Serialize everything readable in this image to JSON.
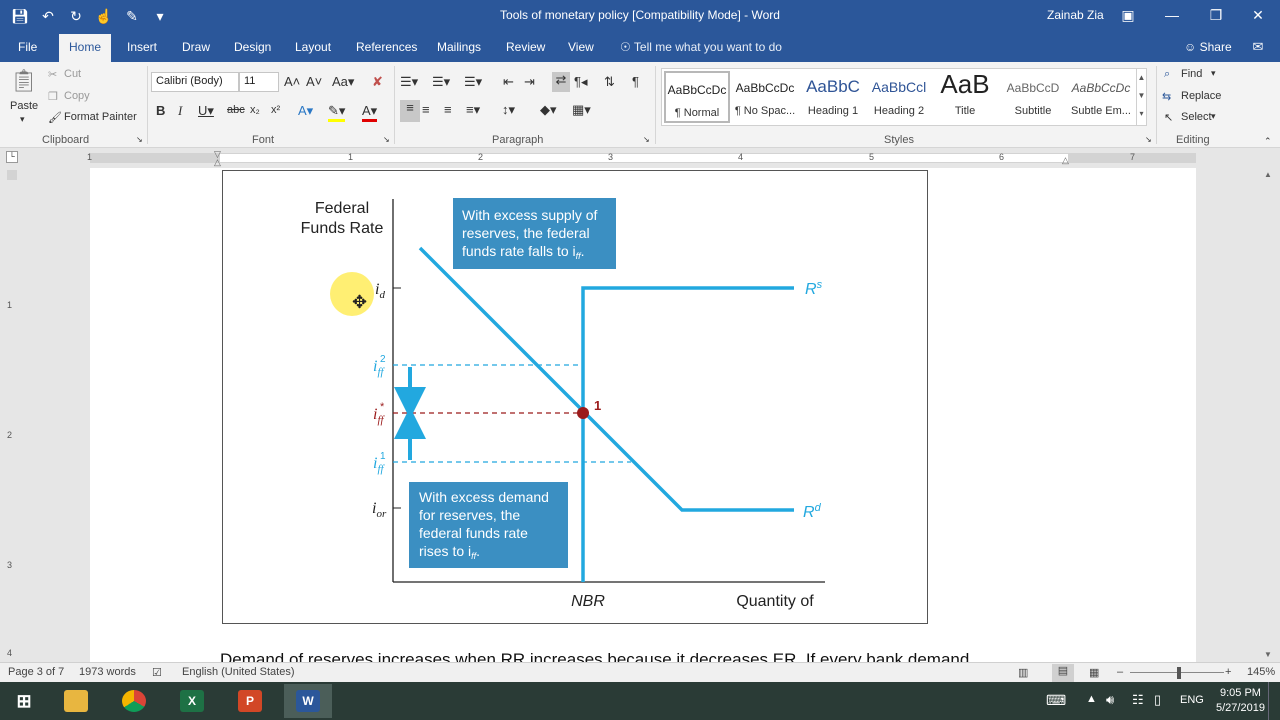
{
  "window": {
    "title": "Tools of monetary policy [Compatibility Mode]  -  Word",
    "user": "Zainab Zia"
  },
  "tabs": {
    "items": [
      "File",
      "Home",
      "Insert",
      "Draw",
      "Design",
      "Layout",
      "References",
      "Mailings",
      "Review",
      "View"
    ],
    "tell_me": "Tell me what you want to do",
    "share": "Share"
  },
  "clipboard": {
    "paste": "Paste",
    "cut": "Cut",
    "copy": "Copy",
    "format_painter": "Format Painter",
    "label": "Clipboard"
  },
  "font": {
    "name": "Calibri (Body)",
    "size": "11",
    "label": "Font"
  },
  "paragraph": {
    "label": "Paragraph"
  },
  "styles": {
    "label": "Styles",
    "items": [
      {
        "preview": "AaBbCcDc",
        "name": "¶ Normal"
      },
      {
        "preview": "AaBbCcDc",
        "name": "¶ No Spac..."
      },
      {
        "preview": "AaBbC",
        "name": "Heading 1"
      },
      {
        "preview": "AaBbCcl",
        "name": "Heading 2"
      },
      {
        "preview": "AaB",
        "name": "Title"
      },
      {
        "preview": "AaBbCcD",
        "name": "Subtitle"
      },
      {
        "preview": "AaBbCcDc",
        "name": "Subtle Em..."
      }
    ]
  },
  "editing": {
    "find": "Find",
    "replace": "Replace",
    "select": "Select",
    "label": "Editing"
  },
  "ruler": {
    "numbers": [
      "1",
      "1",
      "2",
      "3",
      "4",
      "5",
      "6",
      "7"
    ]
  },
  "vruler": {
    "numbers": [
      "1",
      "2",
      "3",
      "4"
    ]
  },
  "figure": {
    "y_title_1": "Federal",
    "y_title_2": "Funds Rate",
    "label_id": "i",
    "label_id_sub": "d",
    "label_iff2": "i",
    "label_iff2_sub": "ff",
    "label_iff2_sup": "2",
    "label_iffstar": "i",
    "label_iffstar_sub": "ff",
    "label_iffstar_sup": "*",
    "label_iff1": "i",
    "label_iff1_sub": "ff",
    "label_iff1_sup": "1",
    "label_ior": "i",
    "label_ior_sub": "or",
    "rs_label": "R",
    "rs_sup": "s",
    "rd_label": "R",
    "rd_sup": "d",
    "point_label": "1",
    "x_nbr": "NBR",
    "x_title": "Quantity of",
    "box_top_1": "With excess supply of",
    "box_top_2": "reserves, the federal",
    "box_top_3": "funds rate falls to i",
    "box_top_3_sub": "ff",
    "box_top_3_end": ".",
    "box_bottom_1": "With excess demand",
    "box_bottom_2": "for reserves, the",
    "box_bottom_3": "federal funds rate",
    "box_bottom_4": "rises to i",
    "box_bottom_4_sub": "ff",
    "box_bottom_4_end": "."
  },
  "doc": {
    "body_text": "Demand of reserves increases when RR increases because it decreases ER. If every bank demand"
  },
  "status": {
    "page": "Page 3 of 7",
    "words": "1973 words",
    "language": "English (United States)",
    "zoom": "145%"
  },
  "taskbar": {
    "lang": "ENG",
    "time": "9:05 PM",
    "date": "5/27/2019"
  },
  "colors": {
    "word_blue": "#2b579a",
    "curve_cyan": "#22a8df",
    "box_blue": "#3b8fc2",
    "equilibrium_red": "#9b1b1b"
  }
}
